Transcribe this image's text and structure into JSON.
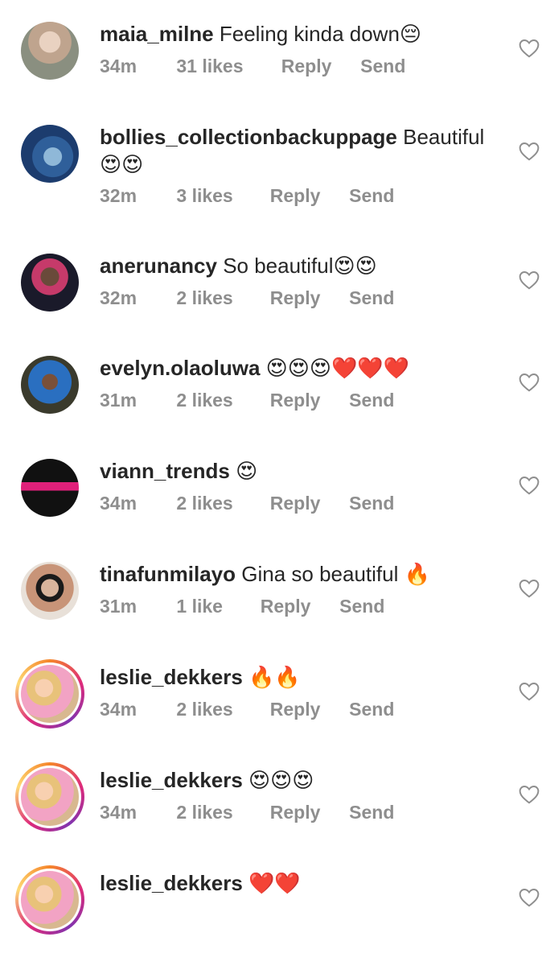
{
  "comments": [
    {
      "username": "maia_milne",
      "text": "Feeling kinda down😔",
      "time": "34m",
      "likes": "31 likes",
      "reply": "Reply",
      "send": "Send"
    },
    {
      "username": "bollies_collectionbackuppage",
      "text": "Beautiful 😍😍",
      "time": "32m",
      "likes": "3 likes",
      "reply": "Reply",
      "send": "Send"
    },
    {
      "username": "anerunancy",
      "text": "So beautiful😍😍",
      "time": "32m",
      "likes": "2 likes",
      "reply": "Reply",
      "send": "Send"
    },
    {
      "username": "evelyn.olaoluwa",
      "text": "😍😍😍❤️❤️❤️",
      "time": "31m",
      "likes": "2 likes",
      "reply": "Reply",
      "send": "Send"
    },
    {
      "username": "viann_trends",
      "text": "😍",
      "time": "34m",
      "likes": "2 likes",
      "reply": "Reply",
      "send": "Send"
    },
    {
      "username": "tinafunmilayo",
      "text": "Gina so beautiful 🔥",
      "time": "31m",
      "likes": "1 like",
      "reply": "Reply",
      "send": "Send"
    },
    {
      "username": "leslie_dekkers",
      "text": "🔥🔥",
      "time": "34m",
      "likes": "2 likes",
      "reply": "Reply",
      "send": "Send"
    },
    {
      "username": "leslie_dekkers",
      "text": "😍😍😍",
      "time": "34m",
      "likes": "2 likes",
      "reply": "Reply",
      "send": "Send"
    },
    {
      "username": "leslie_dekkers",
      "text": "❤️❤️",
      "time": "",
      "likes": "",
      "reply": "",
      "send": ""
    }
  ],
  "icons": {
    "like": "heart-outline-icon"
  },
  "colors": {
    "text": "#262626",
    "meta": "#8e8e8e",
    "heart": "#8e8e8e"
  }
}
